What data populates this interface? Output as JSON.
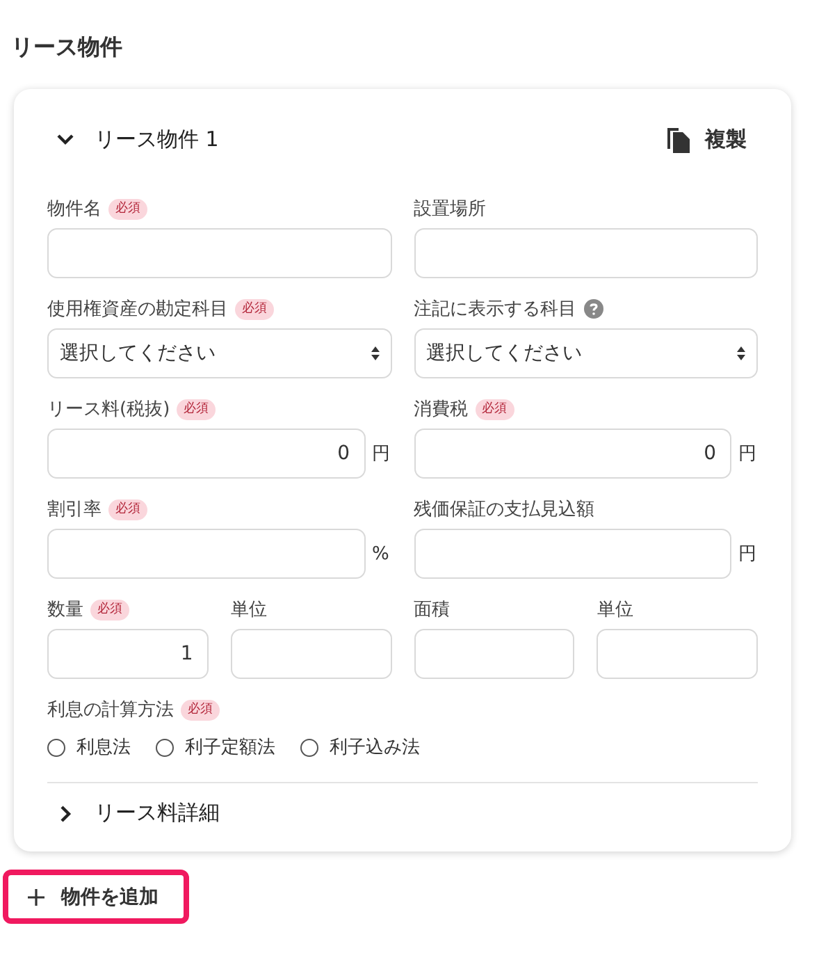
{
  "section_title": "リース物件",
  "card": {
    "title": "リース物件 1",
    "expanded": true,
    "copy_label": "複製",
    "rows": [
      {
        "fields": [
          {
            "kind": "text",
            "label": "物件名",
            "badge": "必須"
          },
          {
            "kind": "text",
            "label": "設置場所"
          }
        ]
      },
      {
        "fields": [
          {
            "kind": "select",
            "label": "使用権資産の勘定科目",
            "badge": "必須",
            "value": "選択してください"
          },
          {
            "kind": "select",
            "label": "注記に表示する科目",
            "help": true,
            "value": "選択してください"
          }
        ]
      },
      {
        "fields": [
          {
            "kind": "number",
            "label": "リース料(税抜)",
            "badge": "必須",
            "value": "0",
            "unit": "円"
          },
          {
            "kind": "number",
            "label": "消費税",
            "badge": "必須",
            "value": "0",
            "unit": "円"
          }
        ]
      },
      {
        "fields": [
          {
            "kind": "number",
            "label": "割引率",
            "badge": "必須",
            "unit": "%"
          },
          {
            "kind": "number",
            "label": "残価保証の支払見込額",
            "unit": "円"
          }
        ]
      },
      {
        "fields": [
          {
            "kind": "number",
            "label": "数量",
            "badge": "必須",
            "value": "1"
          },
          {
            "kind": "text",
            "label": "単位"
          },
          {
            "kind": "text",
            "label": "面積"
          },
          {
            "kind": "text",
            "label": "単位"
          }
        ]
      }
    ],
    "radio_group": {
      "label": "利息の計算方法",
      "badge": "必須",
      "options": [
        {
          "label": "利息法",
          "selected": false
        },
        {
          "label": "利子定額法",
          "selected": false
        },
        {
          "label": "利子込み法",
          "selected": false
        }
      ]
    },
    "details": {
      "label": "リース料詳細",
      "expanded": false
    }
  },
  "add_button": {
    "label": "物件を追加",
    "highlighted": true
  }
}
